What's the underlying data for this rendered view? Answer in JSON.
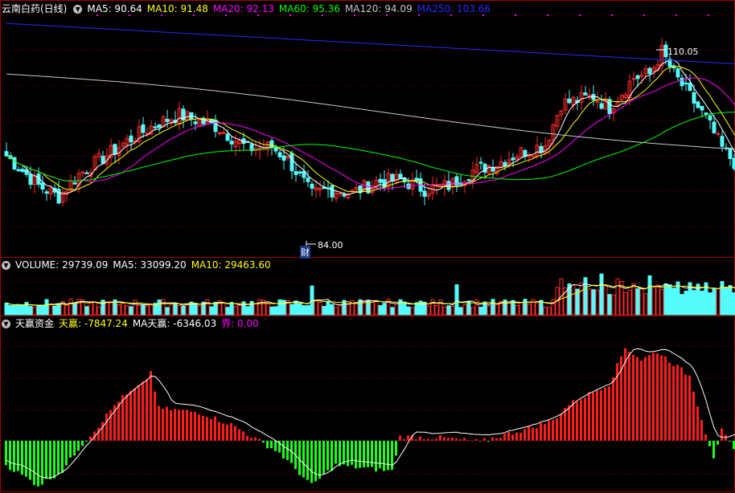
{
  "colors": {
    "background": "#000000",
    "up": "#ff2a2a",
    "down": "#54fcfc",
    "grid": "#7a0000",
    "ma5": "#ffffff",
    "ma10": "#ffff00",
    "ma20": "#ff00ff",
    "ma60": "#00ff00",
    "ma120": "#c8c8c8",
    "ma250": "#2a2aff",
    "flow_pos": "#ff1c1c",
    "flow_neg": "#1cff1c"
  },
  "price_panel": {
    "stock_name": "云南白药(日线)",
    "indicators": [
      {
        "label": "MA5: 90.64",
        "color": "#ffffff"
      },
      {
        "label": "MA10: 91.48",
        "color": "#ffff00"
      },
      {
        "label": "MA20: 92.13",
        "color": "#ff00ff"
      },
      {
        "label": "MA60: 95.36",
        "color": "#00ff00"
      },
      {
        "label": "MA120: 94.09",
        "color": "#c8c8c8"
      },
      {
        "label": "MA250: 103.66",
        "color": "#2a2aff"
      }
    ],
    "high_label": "110.05",
    "low_label": "84.00",
    "event_label": "财",
    "icon": "chevron-down-icon"
  },
  "volume_panel": {
    "indicators": [
      {
        "label": "VOLUME: 29739.09",
        "color": "#ffffff"
      },
      {
        "label": "MA5: 33099.20",
        "color": "#ffffff"
      },
      {
        "label": "MA10: 29463.60",
        "color": "#ffff00"
      }
    ]
  },
  "flow_panel": {
    "title": "天赢资金",
    "indicators": [
      {
        "label": "天赢: -7847.24",
        "color": "#ffff00"
      },
      {
        "label": "MA天赢: -6346.03",
        "color": "#ffffff"
      },
      {
        "label": "界: 0.00",
        "color": "#ff00ff"
      }
    ]
  },
  "chart_data": [
    {
      "type": "candlestick",
      "title": "云南白药(日线)",
      "ylim": [
        82,
        112
      ],
      "annotations": [
        "110.05",
        "84.00",
        "财"
      ],
      "anchors": [
        {
          "i": 0,
          "c": 93.0
        },
        {
          "i": 8,
          "c": 89.0
        },
        {
          "i": 13,
          "c": 87.5
        },
        {
          "i": 18,
          "c": 90.5
        },
        {
          "i": 30,
          "c": 95.0
        },
        {
          "i": 38,
          "c": 97.5
        },
        {
          "i": 43,
          "c": 98.5
        },
        {
          "i": 52,
          "c": 97.0
        },
        {
          "i": 60,
          "c": 94.0
        },
        {
          "i": 66,
          "c": 94.2
        },
        {
          "i": 70,
          "c": 92.5
        },
        {
          "i": 76,
          "c": 87.8
        },
        {
          "i": 80,
          "c": 88.5
        },
        {
          "i": 86,
          "c": 88.0
        },
        {
          "i": 92,
          "c": 89.5
        },
        {
          "i": 98,
          "c": 89.8
        },
        {
          "i": 104,
          "c": 88.5
        },
        {
          "i": 110,
          "c": 89.0
        },
        {
          "i": 116,
          "c": 91.0
        },
        {
          "i": 122,
          "c": 92.0
        },
        {
          "i": 128,
          "c": 93.5
        },
        {
          "i": 134,
          "c": 94.5
        },
        {
          "i": 138,
          "c": 100.0
        },
        {
          "i": 146,
          "c": 101.0
        },
        {
          "i": 150,
          "c": 99.5
        },
        {
          "i": 156,
          "c": 103.5
        },
        {
          "i": 160,
          "c": 104.0
        },
        {
          "i": 163,
          "c": 107.0
        },
        {
          "i": 166,
          "c": 104.0
        },
        {
          "i": 170,
          "c": 101.0
        },
        {
          "i": 174,
          "c": 98.0
        },
        {
          "i": 178,
          "c": 94.0
        },
        {
          "i": 182,
          "c": 91.5
        }
      ]
    },
    {
      "type": "bar",
      "title": "VOLUME",
      "ylim": [
        0,
        75000
      ],
      "spikes": [
        {
          "i": 112,
          "v": 50000
        },
        {
          "i": 138,
          "v": 60000
        },
        {
          "i": 144,
          "v": 62000
        },
        {
          "i": 148,
          "v": 68000
        },
        {
          "i": 152,
          "v": 60000
        },
        {
          "i": 156,
          "v": 52000
        },
        {
          "i": 160,
          "v": 65000
        },
        {
          "i": 76,
          "v": 48000
        }
      ]
    },
    {
      "type": "bar",
      "title": "天赢资金",
      "ylim": [
        -25000,
        55000
      ],
      "anchors": [
        {
          "i": 0,
          "v": -12000
        },
        {
          "i": 8,
          "v": -22000
        },
        {
          "i": 14,
          "v": -15000
        },
        {
          "i": 18,
          "v": -4000
        },
        {
          "i": 22,
          "v": 5000
        },
        {
          "i": 28,
          "v": 20000
        },
        {
          "i": 34,
          "v": 28000
        },
        {
          "i": 36,
          "v": 34000
        },
        {
          "i": 38,
          "v": 16000
        },
        {
          "i": 48,
          "v": 14000
        },
        {
          "i": 56,
          "v": 8000
        },
        {
          "i": 62,
          "v": 1000
        },
        {
          "i": 68,
          "v": -6000
        },
        {
          "i": 76,
          "v": -22000
        },
        {
          "i": 82,
          "v": -12000
        },
        {
          "i": 96,
          "v": -15000
        },
        {
          "i": 98,
          "v": 2000
        },
        {
          "i": 108,
          "v": 1500
        },
        {
          "i": 118,
          "v": -500
        },
        {
          "i": 124,
          "v": 3000
        },
        {
          "i": 130,
          "v": 6000
        },
        {
          "i": 136,
          "v": 10000
        },
        {
          "i": 140,
          "v": 18000
        },
        {
          "i": 146,
          "v": 24000
        },
        {
          "i": 150,
          "v": 28000
        },
        {
          "i": 154,
          "v": 46000
        },
        {
          "i": 158,
          "v": 40000
        },
        {
          "i": 162,
          "v": 44000
        },
        {
          "i": 166,
          "v": 38000
        },
        {
          "i": 170,
          "v": 32000
        },
        {
          "i": 174,
          "v": 4000
        },
        {
          "i": 176,
          "v": -7847
        },
        {
          "i": 178,
          "v": 5000
        },
        {
          "i": 182,
          "v": -8000
        }
      ]
    }
  ]
}
